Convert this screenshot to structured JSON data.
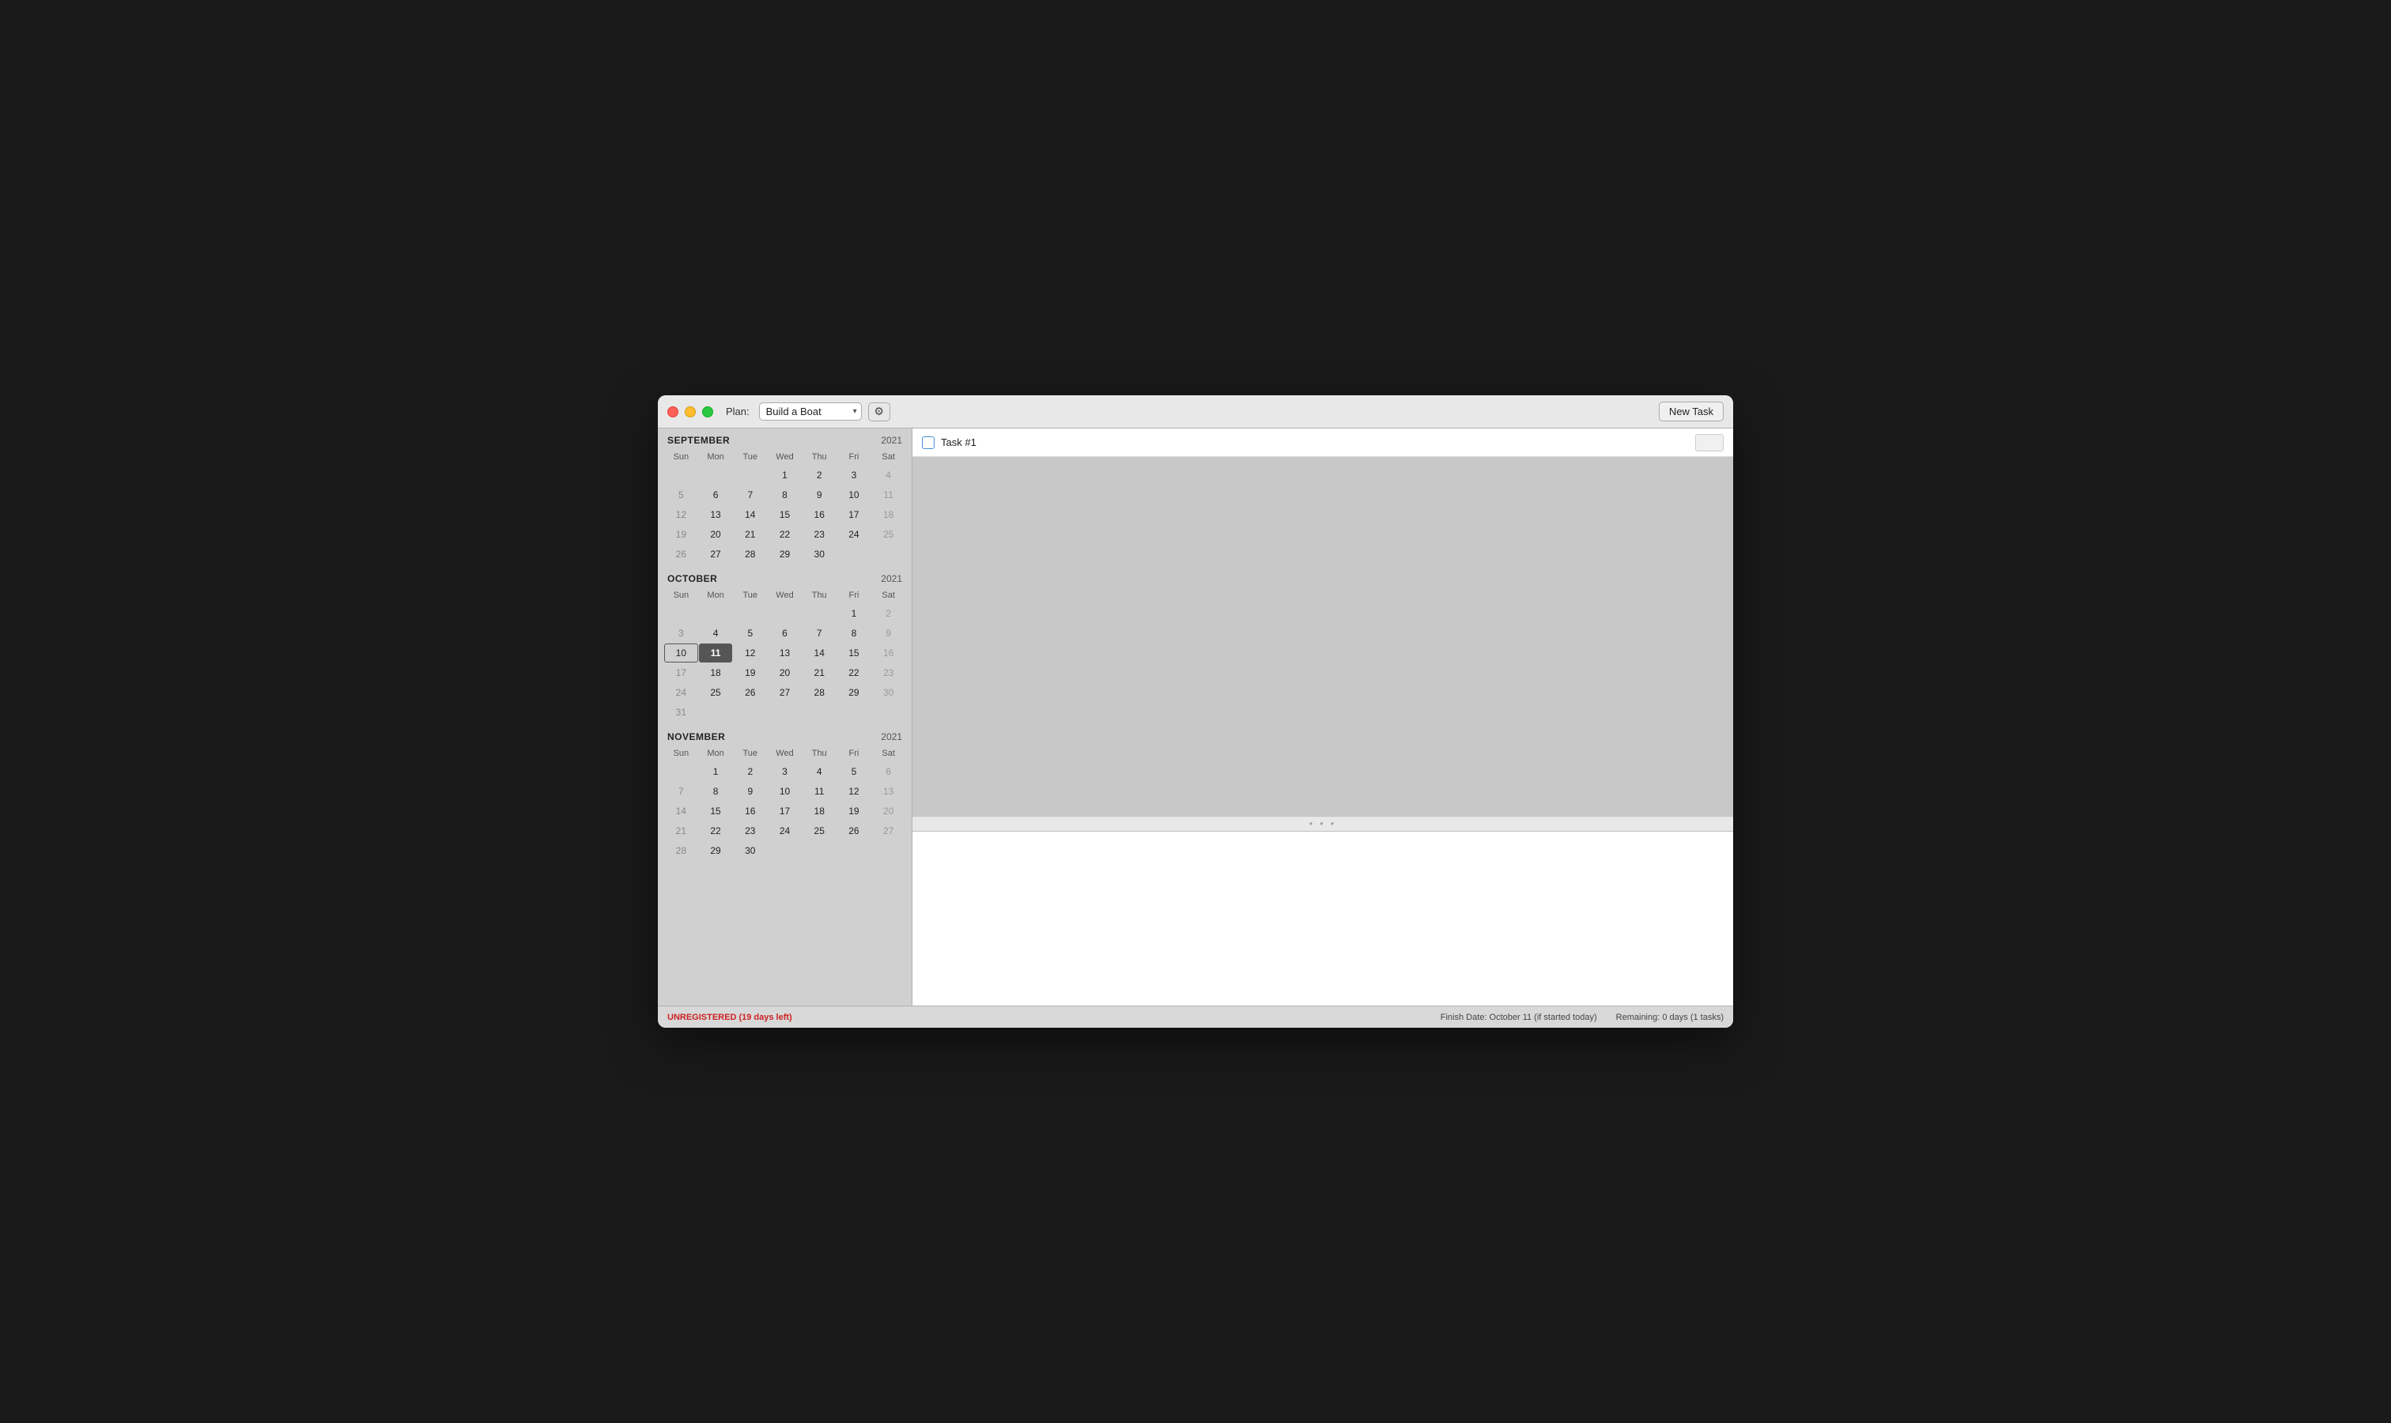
{
  "window": {
    "title": "Build a Boat"
  },
  "toolbar": {
    "plan_label": "Plan:",
    "plan_value": "Build a Boat",
    "new_task_label": "New Task"
  },
  "months": [
    {
      "name": "SEPTEMBER",
      "year": "2021",
      "day_headers": [
        "Sun",
        "Mon",
        "Tue",
        "Wed",
        "Thu",
        "Fri",
        "Sat"
      ],
      "weeks": [
        [
          "",
          "",
          "",
          "1",
          "2",
          "3",
          "4"
        ],
        [
          "5",
          "6",
          "7",
          "8",
          "9",
          "10",
          "11"
        ],
        [
          "12",
          "13",
          "14",
          "15",
          "16",
          "17",
          "18"
        ],
        [
          "19",
          "20",
          "21",
          "22",
          "23",
          "24",
          "25"
        ],
        [
          "26",
          "27",
          "28",
          "29",
          "30",
          "",
          ""
        ]
      ],
      "weekend_cols": [
        0,
        6
      ],
      "muted_days": [
        "4",
        "11",
        "18",
        "25"
      ]
    },
    {
      "name": "OCTOBER",
      "year": "2021",
      "day_headers": [
        "Sun",
        "Mon",
        "Tue",
        "Wed",
        "Thu",
        "Fri",
        "Sat"
      ],
      "weeks": [
        [
          "",
          "",
          "",
          "",
          "",
          "1",
          "2"
        ],
        [
          "3",
          "4",
          "5",
          "6",
          "7",
          "8",
          "9"
        ],
        [
          "10",
          "11",
          "12",
          "13",
          "14",
          "15",
          "16"
        ],
        [
          "17",
          "18",
          "19",
          "20",
          "21",
          "22",
          "23"
        ],
        [
          "24",
          "25",
          "26",
          "27",
          "28",
          "29",
          "30"
        ],
        [
          "31",
          "",
          "",
          "",
          "",
          "",
          ""
        ]
      ],
      "weekend_cols": [
        0,
        6
      ],
      "today_box": "10",
      "today_highlight": "11",
      "muted_days": [
        "2",
        "9",
        "16",
        "23",
        "30"
      ]
    },
    {
      "name": "NOVEMBER",
      "year": "2021",
      "day_headers": [
        "Sun",
        "Mon",
        "Tue",
        "Wed",
        "Thu",
        "Fri",
        "Sat"
      ],
      "weeks": [
        [
          "",
          "1",
          "2",
          "3",
          "4",
          "5",
          "6"
        ],
        [
          "7",
          "8",
          "9",
          "10",
          "11",
          "12",
          "13"
        ],
        [
          "14",
          "15",
          "16",
          "17",
          "18",
          "19",
          "20"
        ],
        [
          "21",
          "22",
          "23",
          "24",
          "25",
          "26",
          "27"
        ],
        [
          "28",
          "29",
          "30",
          "",
          "",
          "",
          ""
        ]
      ],
      "weekend_cols": [
        0,
        6
      ],
      "muted_days": [
        "6",
        "13",
        "20",
        "27"
      ]
    }
  ],
  "tasks": [
    {
      "id": 1,
      "name": "Task #1",
      "checked": false
    }
  ],
  "divider": {
    "dots": "• • •"
  },
  "status": {
    "unregistered": "UNREGISTERED (19 days left)",
    "finish_date": "Finish Date: October 11 (if started today)",
    "remaining": "Remaining: 0 days (1 tasks)"
  }
}
